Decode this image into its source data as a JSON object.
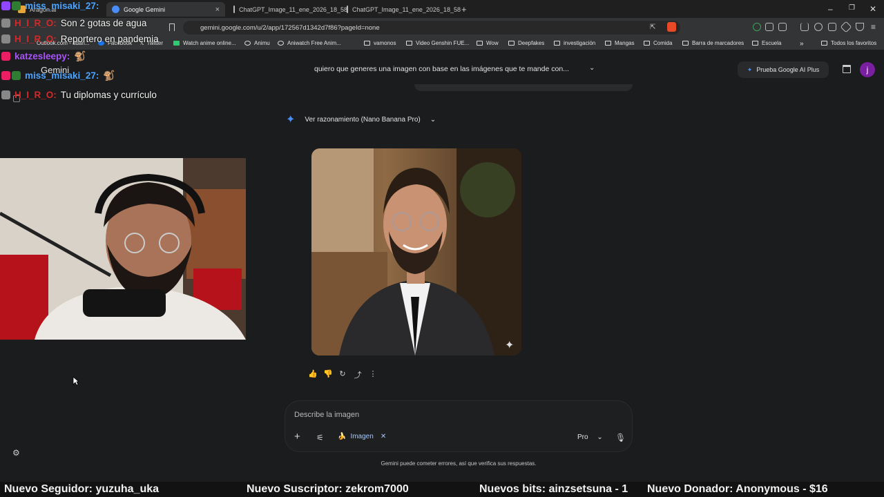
{
  "browser": {
    "tabs": [
      {
        "label": "Aragon.ai",
        "active": false
      },
      {
        "label": "Google Gemini",
        "active": true
      },
      {
        "label": "ChatGPT_Image_11_ene_2026_18_58",
        "active": false
      },
      {
        "label": "ChatGPT_Image_11_ene_2026_18_58",
        "active": false
      }
    ],
    "url": "gemini.google.com/u/2/app/172567d1342d7f86?pageId=none",
    "bookmarks": [
      "Outlook.com - adan...",
      "Facebook",
      "Twitter",
      "Watch anime online...",
      "Animu",
      "Aniwatch Free Anim...",
      "vamonos",
      "Video Genshin FUE...",
      "Wow",
      "Deepfakes",
      "investigación",
      "Mangas",
      "Comida",
      "Barra de marcadores",
      "Escuela"
    ],
    "all_favorites_label": "Todos los favoritos"
  },
  "gemini": {
    "app_title": "Gemini",
    "conversation_title": "quiero que generes una imagen con base en las imágenes que te mande con...",
    "upgrade_button": "Prueba Google AI Plus",
    "avatar_letter": "j",
    "reasoning_label": "Ver razonamiento (Nano Banana Pro)",
    "prompt": {
      "placeholder": "Describe la imagen",
      "tool_chip": "Imagen",
      "model_label": "Pro"
    },
    "disclaimer": "Gemini puede cometer errores, así que verifica sus respuestas."
  },
  "stream_chat": [
    {
      "user": "miss_misaki_27:",
      "user_color": "#4aa3ff",
      "message": ""
    },
    {
      "user": "H_I_R_O:",
      "user_color": "#d62828",
      "message": "Son 2 gotas de agua"
    },
    {
      "user": "H_I_R_O:",
      "user_color": "#d62828",
      "message": "Reportero en pandemia"
    },
    {
      "user": "katzesleepy:",
      "user_color": "#a855f7",
      "message": ""
    },
    {
      "user": "miss_misaki_27:",
      "user_color": "#4aa3ff",
      "message": ""
    },
    {
      "user": "H_I_R_O:",
      "user_color": "#d62828",
      "message": "Tu diplomas y currículo"
    }
  ],
  "ticker": {
    "follower": "Nuevo Seguidor: yuzuha_uka",
    "subscriber": "Nuevo Suscriptor: zekrom7000",
    "bits": "Nuevos bits: ainzsetsuna - 1",
    "donor": "Nuevo Donador: Anonymous - $16"
  },
  "colors": {
    "accent_blue": "#4a8df8",
    "chip_blue": "#a8c7fa",
    "avatar_purple": "#7b1fa2",
    "background": "#1b1c1d"
  },
  "icons": [
    "thumbs-up-icon",
    "thumbs-down-icon",
    "regenerate-icon",
    "share-icon",
    "more-icon",
    "plus-icon",
    "tune-icon",
    "mic-icon",
    "settings-icon",
    "sparkle-icon"
  ]
}
